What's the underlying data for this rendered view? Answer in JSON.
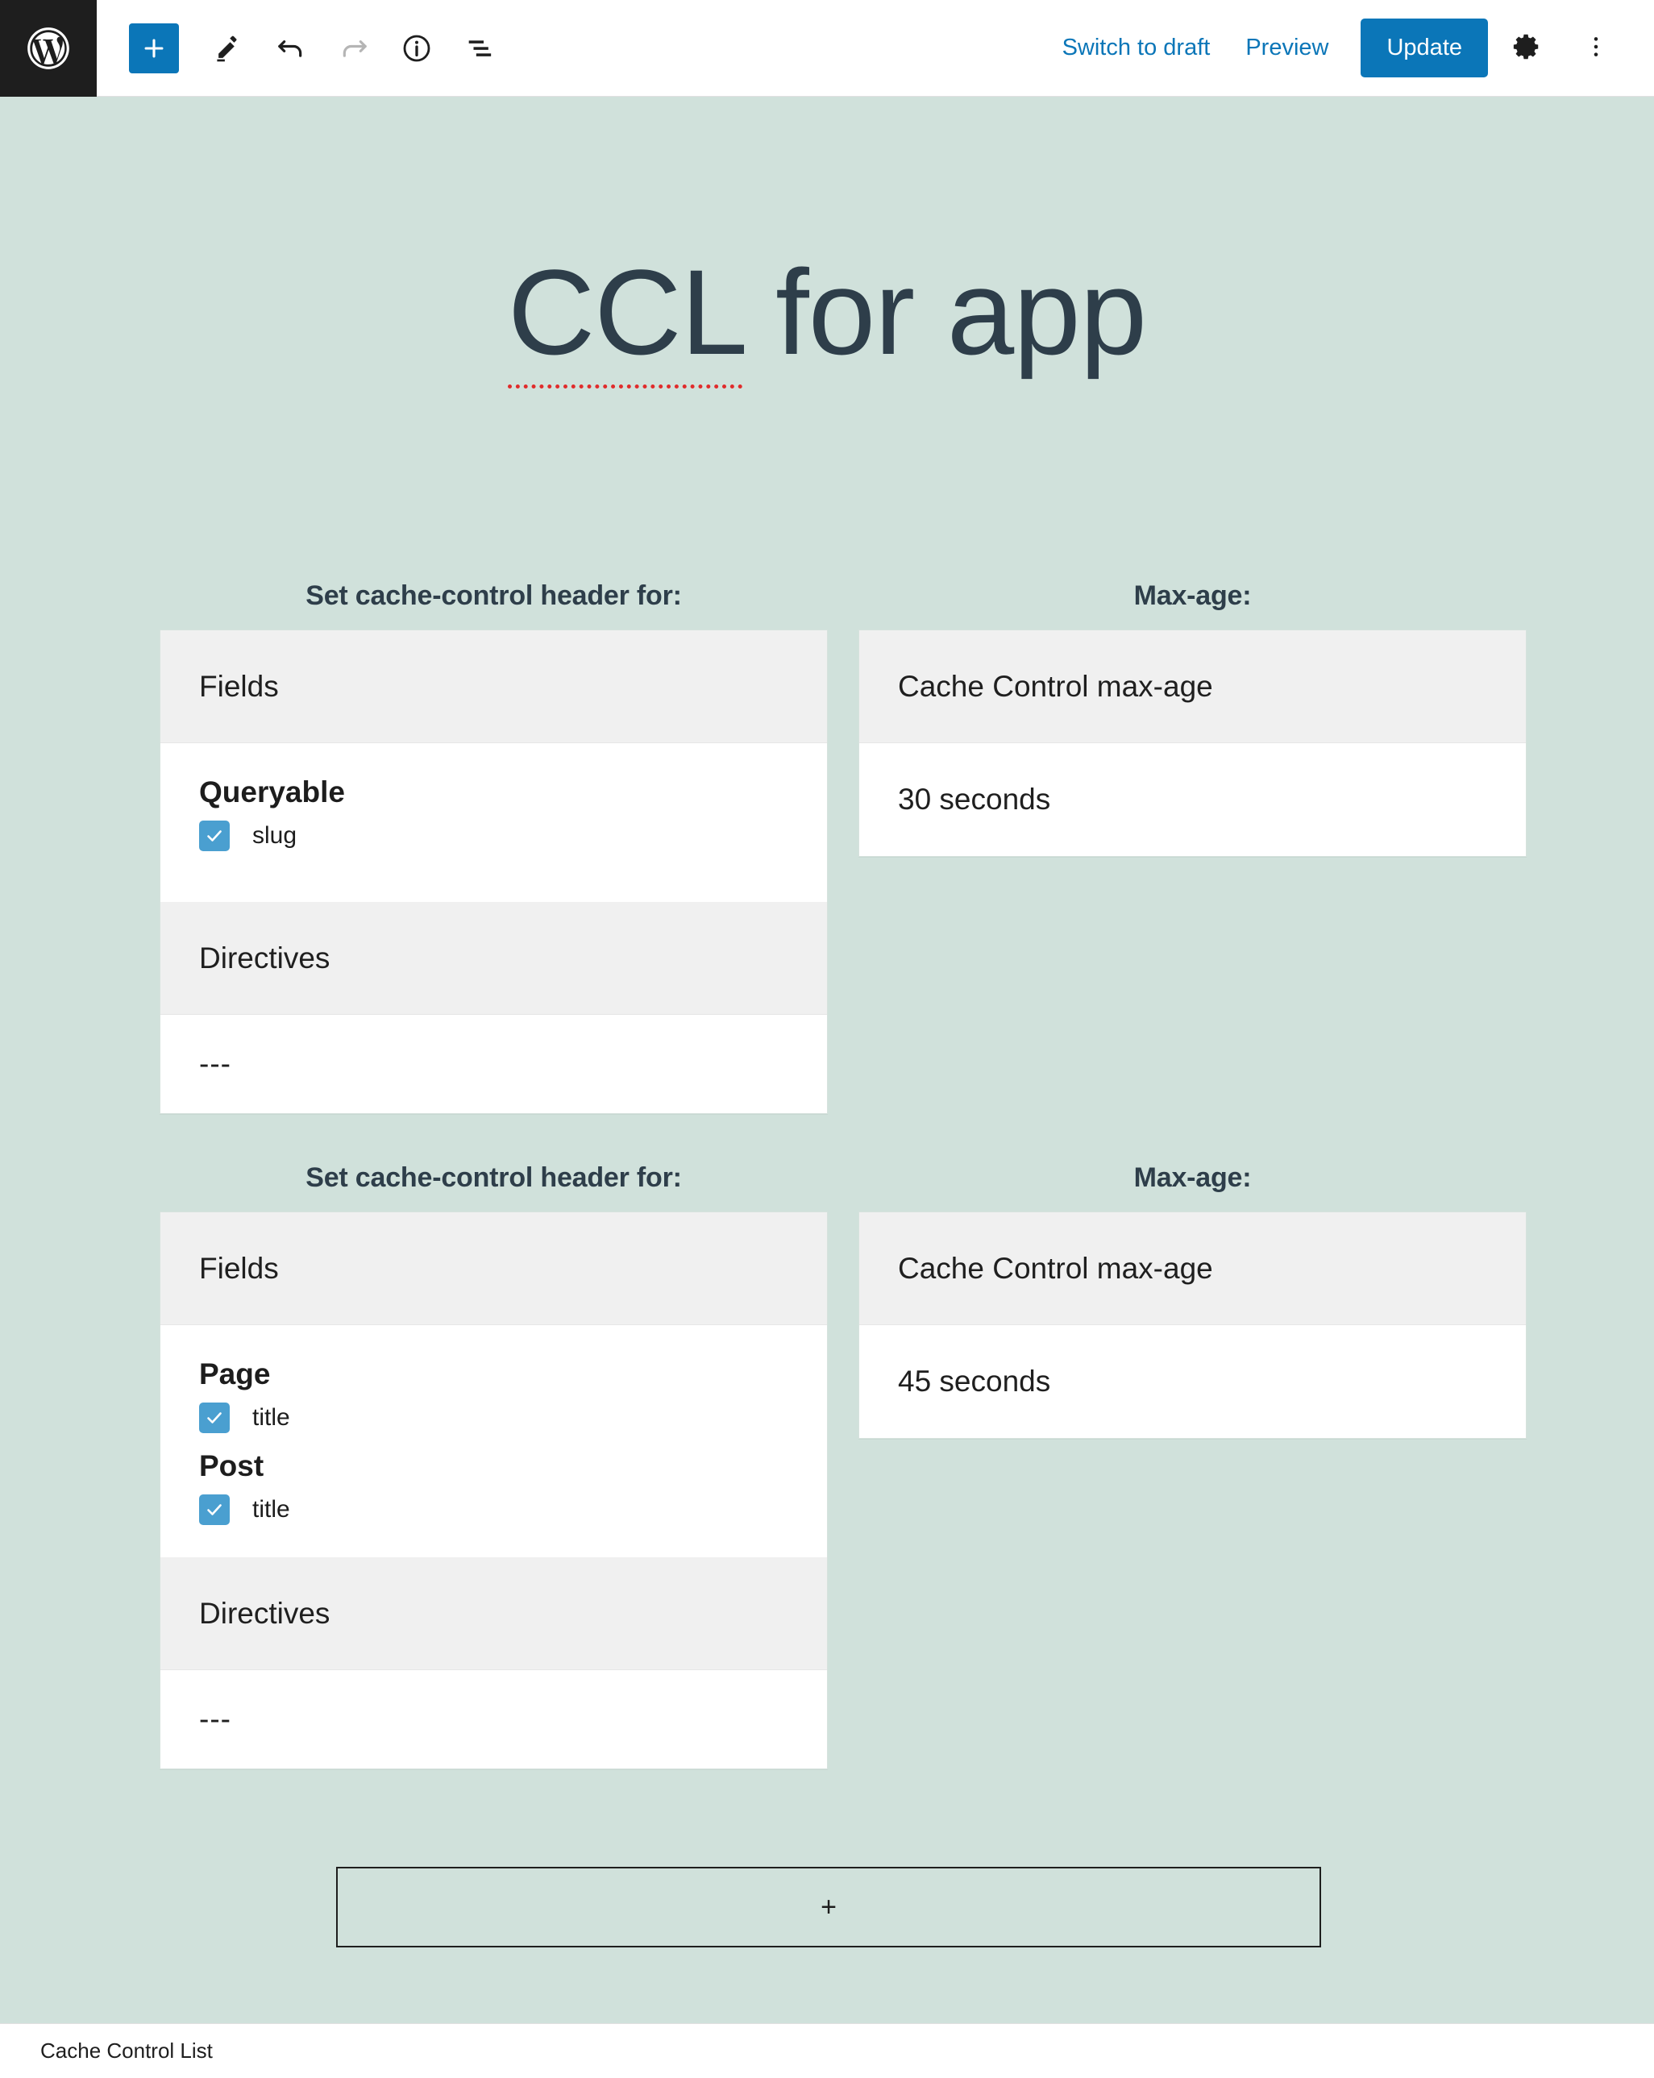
{
  "app": {
    "name": "WordPress Block Editor",
    "logo_icon": "wordpress-logo-icon"
  },
  "toolbar": {
    "left_tools": [
      {
        "name": "add-block",
        "icon": "plus-icon",
        "label": "+"
      },
      {
        "name": "edit-tool",
        "icon": "pencil-icon",
        "label": ""
      },
      {
        "name": "undo",
        "icon": "undo-arrow-icon",
        "label": ""
      },
      {
        "name": "redo",
        "icon": "redo-arrow-icon",
        "label": ""
      },
      {
        "name": "details",
        "icon": "info-circle-icon",
        "label": ""
      },
      {
        "name": "list-view",
        "icon": "list-view-icon",
        "label": ""
      }
    ],
    "switch_to_draft_label": "Switch to draft",
    "preview_label": "Preview",
    "update_label": "Update",
    "settings_icon": "gear-icon",
    "options_icon": "three-dots-vertical-icon",
    "accent_color": "#0b76b8"
  },
  "editor": {
    "background_color": "#d0e1db",
    "post_title": {
      "misspelled_part": "CCL",
      "rest": " for app"
    },
    "add_block_button": {
      "label": "+",
      "name": "add-cache-control-entry-button"
    }
  },
  "entries": [
    {
      "fields_label": "Set cache-control header for:",
      "maxage_label": "Max-age:",
      "card": {
        "fields_heading": "Fields",
        "groups": [
          {
            "name": "Queryable",
            "fields": [
              {
                "label": "slug",
                "checked": true
              }
            ]
          }
        ],
        "directives_heading": "Directives",
        "directives_value": "---"
      },
      "maxage": {
        "heading": "Cache Control max-age",
        "value": "30 seconds"
      }
    },
    {
      "fields_label": "Set cache-control header for:",
      "maxage_label": "Max-age:",
      "card": {
        "fields_heading": "Fields",
        "groups": [
          {
            "name": "Page",
            "fields": [
              {
                "label": "title",
                "checked": true
              }
            ]
          },
          {
            "name": "Post",
            "fields": [
              {
                "label": "title",
                "checked": true
              }
            ]
          }
        ],
        "directives_heading": "Directives",
        "directives_value": "---"
      },
      "maxage": {
        "heading": "Cache Control max-age",
        "value": "45 seconds"
      }
    }
  ],
  "footer": {
    "breadcrumb": "Cache Control List"
  },
  "colors": {
    "checkbox_blue": "#4a9fd0",
    "card_header_grey": "#f0f0f0",
    "title_ink": "#2e3e4a",
    "spellcheck_red": "#e02c2c"
  }
}
